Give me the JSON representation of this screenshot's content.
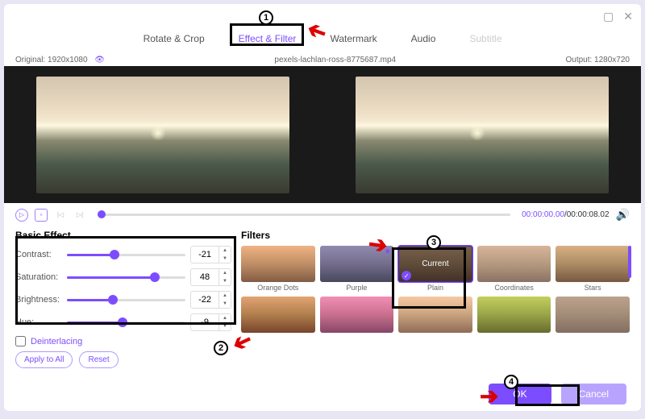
{
  "tabs": {
    "rotate": "Rotate & Crop",
    "effect": "Effect & Filter",
    "watermark": "Watermark",
    "audio": "Audio",
    "subtitle": "Subtitle"
  },
  "info": {
    "original": "Original: 1920x1080",
    "filename": "pexels-lachlan-ross-8775687.mp4",
    "output": "Output: 1280x720"
  },
  "transport": {
    "current": "00:00:00.00",
    "duration": "/00:00:08.02"
  },
  "basic": {
    "title": "Basic Effect",
    "contrast_label": "Contrast:",
    "contrast_value": "-21",
    "contrast_pct": 40,
    "saturation_label": "Saturation:",
    "saturation_value": "48",
    "saturation_pct": 74,
    "brightness_label": "Brightness:",
    "brightness_value": "-22",
    "brightness_pct": 39,
    "hue_label": "Hue:",
    "hue_value": "-9",
    "hue_pct": 47,
    "deinterlacing": "Deinterlacing",
    "apply_all": "Apply to All",
    "reset": "Reset"
  },
  "filters": {
    "title": "Filters",
    "current_overlay": "Current",
    "items": [
      {
        "label": "Orange Dots",
        "cls": "f-orange"
      },
      {
        "label": "Purple",
        "cls": "f-purple",
        "star": true
      },
      {
        "label": "Plain",
        "cls": "f-plain",
        "selected": true
      },
      {
        "label": "Coordinates",
        "cls": "f-coord"
      },
      {
        "label": "Stars",
        "cls": "f-stars"
      },
      {
        "label": "",
        "cls": "f-g1"
      },
      {
        "label": "",
        "cls": "f-g2"
      },
      {
        "label": "",
        "cls": "f-g3"
      },
      {
        "label": "",
        "cls": "f-g4"
      },
      {
        "label": "",
        "cls": "f-g5"
      }
    ]
  },
  "footer": {
    "ok": "OK",
    "cancel": "Cancel"
  },
  "annotations": [
    "1",
    "2",
    "3",
    "4"
  ]
}
